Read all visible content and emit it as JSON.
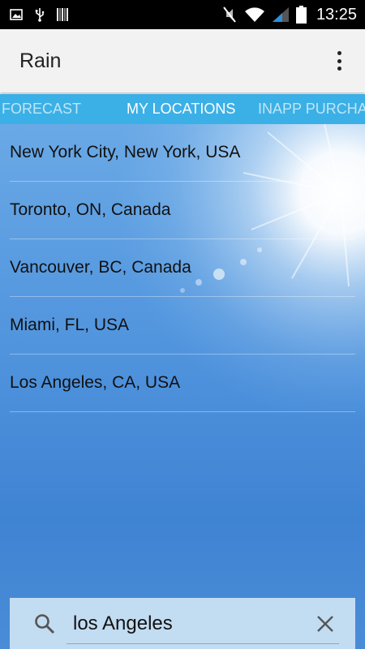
{
  "status_bar": {
    "time": "13:25",
    "icons": [
      "image-icon",
      "usb-icon",
      "barcode-icon",
      "mute-icon",
      "wifi-icon",
      "signal-icon",
      "battery-icon"
    ]
  },
  "app_bar": {
    "title": "Rain",
    "menu_icon": "more-vert-icon"
  },
  "tabs": [
    {
      "label": "FORECAST",
      "selected": false
    },
    {
      "label": "MY LOCATIONS",
      "selected": true
    },
    {
      "label": "INAPP PURCHA",
      "selected": false
    }
  ],
  "locations": [
    {
      "label": "New York City, New York, USA"
    },
    {
      "label": "Toronto, ON, Canada"
    },
    {
      "label": "Vancouver, BC, Canada"
    },
    {
      "label": "Miami, FL, USA"
    },
    {
      "label": "Los Angeles, CA, USA"
    }
  ],
  "search": {
    "value": "los Angeles",
    "search_icon": "search-icon",
    "clear_icon": "close-icon"
  },
  "colors": {
    "tab_bar": "#3bb0e6",
    "app_bar": "#f2f2f2",
    "sky": "#4f93dd"
  }
}
